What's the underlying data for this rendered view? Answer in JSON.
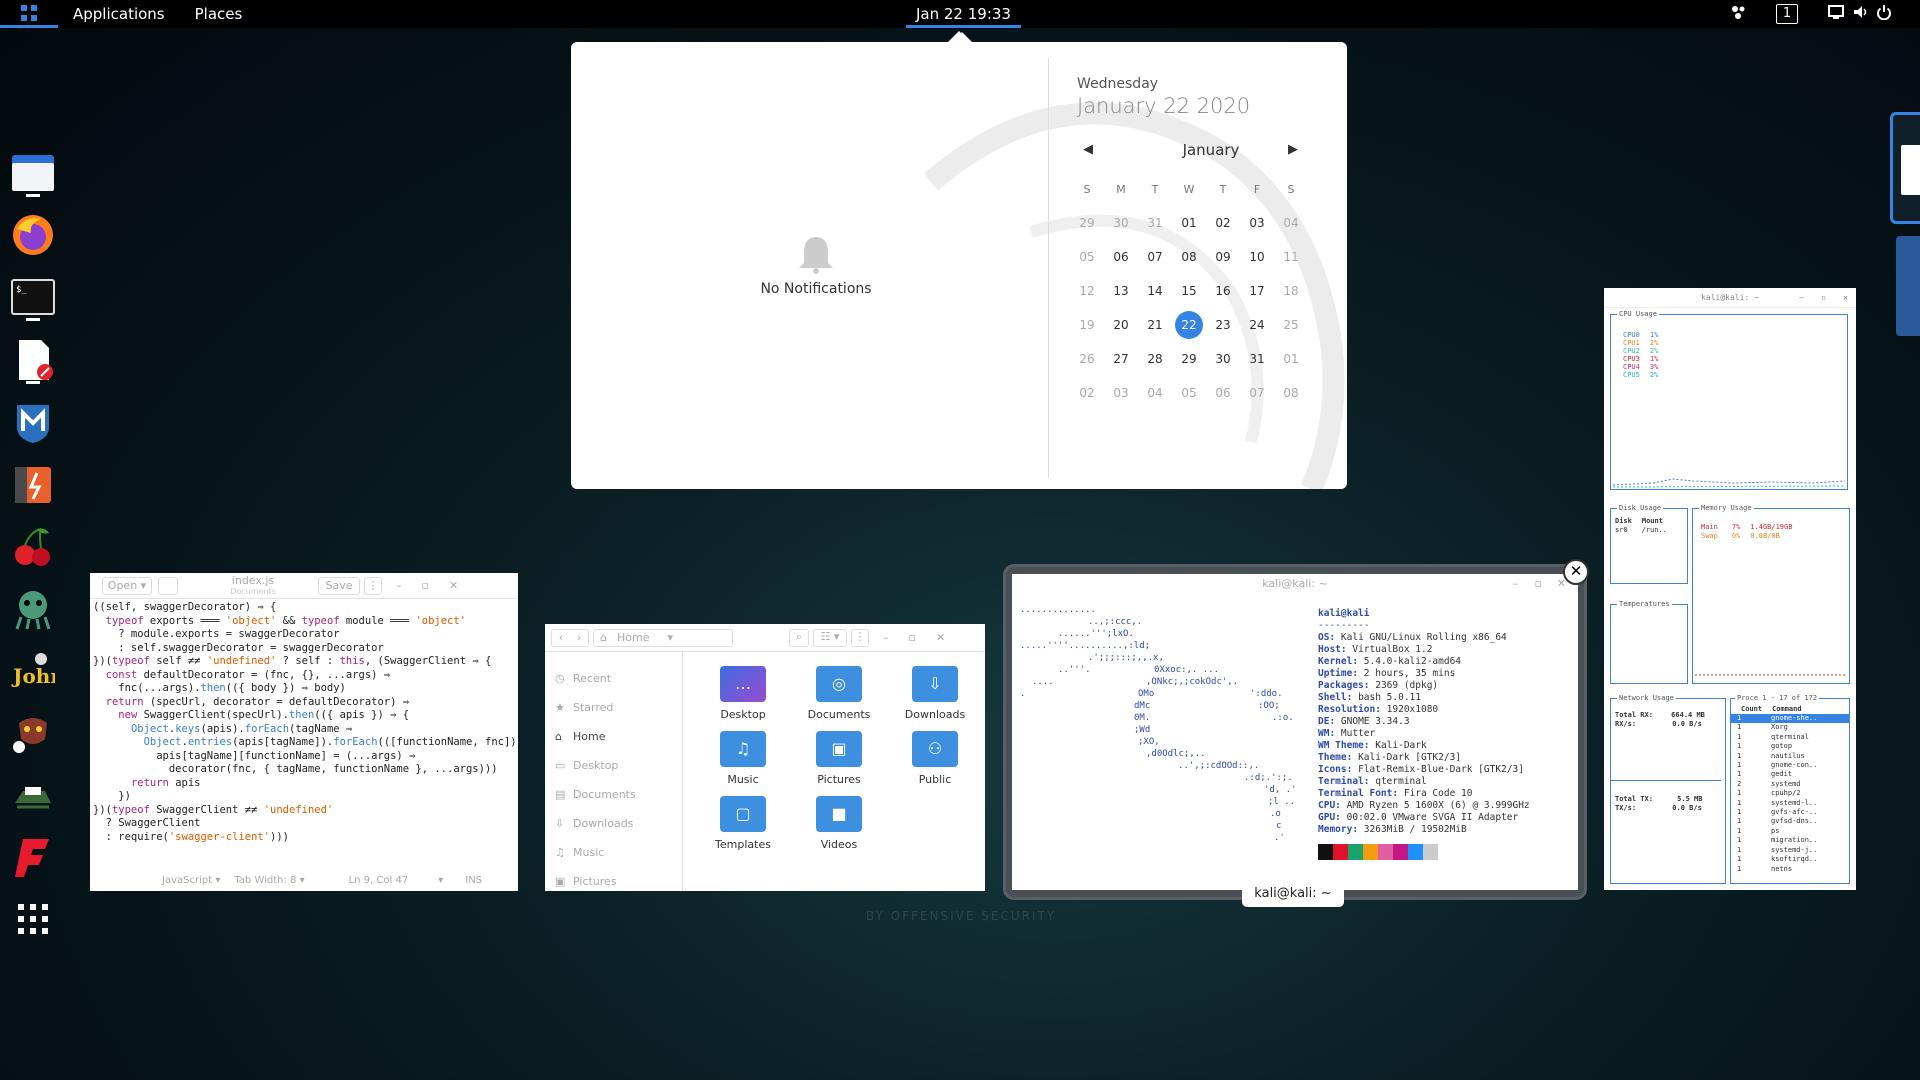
{
  "topbar": {
    "applications": "Applications",
    "places": "Places",
    "clock": "Jan 22  19:33",
    "workspace": "1"
  },
  "dock": {
    "icons": [
      "files-icon",
      "firefox-icon",
      "terminal-icon",
      "text-editor-icon",
      "metasploit-icon",
      "burpsuite-icon",
      "cherrytree-icon",
      "maltego-icon",
      "john-icon",
      "beef-icon",
      "armitage-icon",
      "faraday-icon",
      "app-grid-icon"
    ]
  },
  "calendar": {
    "weekday": "Wednesday",
    "date": "January 22 2020",
    "month": "January",
    "no_notifications": "No Notifications",
    "dow": [
      "S",
      "M",
      "T",
      "W",
      "T",
      "F",
      "S"
    ],
    "weeks": [
      [
        "29",
        "30",
        "31",
        "01",
        "02",
        "03",
        "04"
      ],
      [
        "05",
        "06",
        "07",
        "08",
        "09",
        "10",
        "11"
      ],
      [
        "12",
        "13",
        "14",
        "15",
        "16",
        "17",
        "18"
      ],
      [
        "19",
        "20",
        "21",
        "22",
        "23",
        "24",
        "25"
      ],
      [
        "26",
        "27",
        "28",
        "29",
        "30",
        "31",
        "01"
      ],
      [
        "02",
        "03",
        "04",
        "05",
        "06",
        "07",
        "08"
      ]
    ],
    "dim_cells": [
      "0-0",
      "0-1",
      "0-2",
      "0-6",
      "1-0",
      "1-6",
      "2-0",
      "2-6",
      "3-0",
      "3-6",
      "4-0",
      "4-6",
      "5-0",
      "5-1",
      "5-2",
      "5-3",
      "5-4",
      "5-5",
      "5-6"
    ],
    "today": "3-3"
  },
  "editor": {
    "open": "Open",
    "filename": "index.js",
    "subtitle": "Documents",
    "save": "Save",
    "status_lang": "JavaScript",
    "status_tab": "Tab Width: 8",
    "status_pos": "Ln 9, Col 47",
    "status_ins": "INS"
  },
  "files": {
    "location": "Home",
    "sidebar": [
      "Recent",
      "Starred",
      "Home",
      "Desktop",
      "Documents",
      "Downloads",
      "Music",
      "Pictures"
    ],
    "folders": [
      "Desktop",
      "Documents",
      "Downloads",
      "Music",
      "Pictures",
      "Public",
      "Templates",
      "Videos"
    ]
  },
  "terminal": {
    "title": "kali@kali: ~",
    "user": "kali@kali",
    "sep": "---------",
    "info": [
      [
        "OS:",
        "Kali GNU/Linux Rolling x86_64"
      ],
      [
        "Host:",
        "VirtualBox 1.2"
      ],
      [
        "Kernel:",
        "5.4.0-kali2-amd64"
      ],
      [
        "Uptime:",
        "2 hours, 35 mins"
      ],
      [
        "Packages:",
        "2369 (dpkg)"
      ],
      [
        "Shell:",
        "bash 5.0.11"
      ],
      [
        "Resolution:",
        "1920x1080"
      ],
      [
        "DE:",
        "GNOME 3.34.3"
      ],
      [
        "WM:",
        "Mutter"
      ],
      [
        "WM Theme:",
        "Kali-Dark"
      ],
      [
        "Theme:",
        "Kali-Dark [GTK2/3]"
      ],
      [
        "Icons:",
        "Flat-Remix-Blue-Dark [GTK2/3]"
      ],
      [
        "Terminal:",
        "qterminal"
      ],
      [
        "Terminal Font:",
        "Fira Code 10"
      ],
      [
        "CPU:",
        "AMD Ryzen 5 1600X (6) @ 3.999GHz"
      ],
      [
        "GPU:",
        "00:02.0 VMware SVGA II Adapter"
      ],
      [
        "Memory:",
        "3263MiB / 19502MiB"
      ]
    ],
    "palette": [
      "#111111",
      "#e0112b",
      "#18a36b",
      "#f39c12",
      "#e05fa0",
      "#c71585",
      "#1e90ff",
      "#cccccc"
    ],
    "caption": "kali@kali: ~"
  },
  "sysmon": {
    "title": "kali@kali: ~",
    "cpu_label": "CPU Usage",
    "cpus": [
      [
        "CPU0",
        "1%",
        "#3f7fdf"
      ],
      [
        "CPU1",
        "2%",
        "#e08a20"
      ],
      [
        "CPU2",
        "2%",
        "#3fbf9f"
      ],
      [
        "CPU3",
        "1%",
        "#d03030"
      ],
      [
        "CPU4",
        "3%",
        "#c03070"
      ],
      [
        "CPU5",
        "2%",
        "#3fa0e0"
      ]
    ],
    "disk_label": "Disk Usage",
    "disk_head": [
      "Disk",
      "Mount"
    ],
    "disk_row": [
      "sr0",
      "/run.."
    ],
    "mem_label": "Memory Usage",
    "mem_rows": [
      [
        "Main",
        "7%",
        "1.4GB/19GB",
        "#d03030"
      ],
      [
        "Swap",
        "0%",
        "0.0B/0B",
        "#e08a20"
      ]
    ],
    "temp_label": "Temperatures",
    "net_label": "Network Usage",
    "rx": [
      "Total RX:",
      "664.4 MB"
    ],
    "rxs": [
      "RX/s:",
      "0.0  B/s"
    ],
    "tx": [
      "Total TX:",
      "5.5 MB"
    ],
    "txs": [
      "TX/s:",
      "0.0  B/s"
    ],
    "proc_label": "Proce 1 - 17 of 172",
    "proc_head": [
      "Count",
      "Command"
    ],
    "procs": [
      [
        "1",
        "gnome-she.."
      ],
      [
        "1",
        "Xorg"
      ],
      [
        "1",
        "qterminal"
      ],
      [
        "1",
        "gotop"
      ],
      [
        "1",
        "nautilus"
      ],
      [
        "1",
        "gnome-con.."
      ],
      [
        "1",
        "gedit"
      ],
      [
        "2",
        "systemd"
      ],
      [
        "1",
        "cpuhp/2"
      ],
      [
        "1",
        "systemd-l.."
      ],
      [
        "1",
        "gvfs-afc-.."
      ],
      [
        "1",
        "gvfsd-dns.."
      ],
      [
        "1",
        "ps"
      ],
      [
        "1",
        "migration.."
      ],
      [
        "1",
        "systemd-j.."
      ],
      [
        "1",
        "ksoftirqd.."
      ],
      [
        "1",
        "netns"
      ]
    ]
  }
}
